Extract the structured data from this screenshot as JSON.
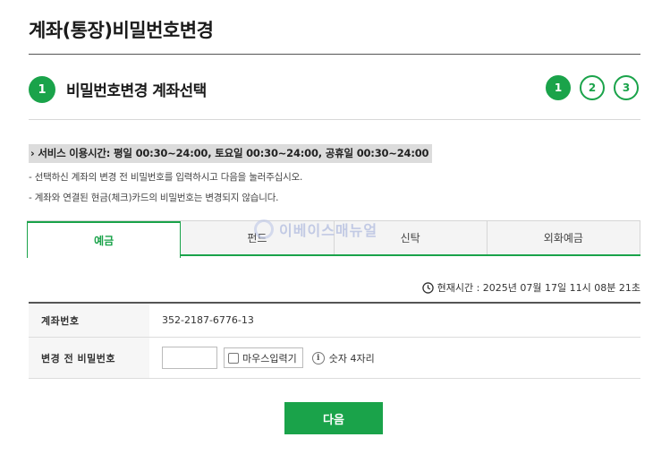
{
  "page": {
    "title": "계좌(통장)비밀번호변경"
  },
  "step": {
    "current_number": "1",
    "title": "비밀번호변경 계좌선택",
    "steps": [
      "1",
      "2",
      "3"
    ]
  },
  "notices": {
    "service_hours": "› 서비스 이용시간: 평일 00:30~24:00, 토요일 00:30~24:00, 공휴일 00:30~24:00",
    "lines": [
      "- 선택하신 계좌의 변경 전 비밀번호를 입력하시고 다음을 눌러주십시오.",
      "- 계좌와 연결된 현금(체크)카드의 비밀번호는 변경되지 않습니다."
    ]
  },
  "tabs": [
    {
      "label": "예금",
      "active": true
    },
    {
      "label": "펀드",
      "active": false
    },
    {
      "label": "신탁",
      "active": false
    },
    {
      "label": "외화예금",
      "active": false
    }
  ],
  "watermark": {
    "text": "이베이스매뉴얼"
  },
  "clock": {
    "icon": "clock-icon",
    "label": "현재시간 : 2025년 07월 17일 11시 08분 21초"
  },
  "form": {
    "account_label": "계좌번호",
    "account_value": "352-2187-6776-13",
    "password_label": "변경 전 비밀번호",
    "password_value": "",
    "mouse_input_label": "마우스입력기",
    "info_icon": "info-icon",
    "hint": "숫자 4자리"
  },
  "actions": {
    "next_label": "다음"
  },
  "colors": {
    "accent": "#1aa34a",
    "tab_bg": "#f4f4f4",
    "header_bg": "#f6f6f6"
  }
}
